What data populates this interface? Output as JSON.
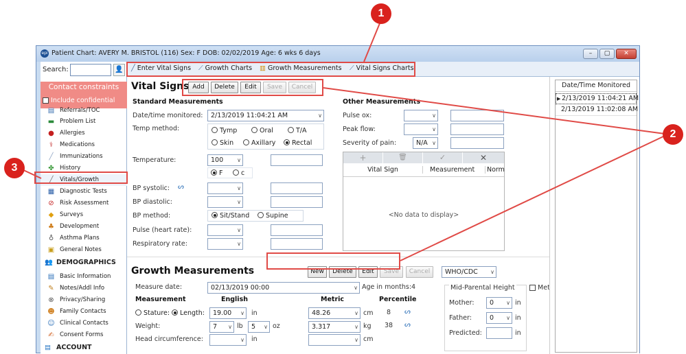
{
  "window": {
    "title": "Patient Chart: AVERY M. BRISTOL (116)  Sex: F  DOB: 02/02/2019  Age: 6 wks 6 days",
    "logo_text": "epi",
    "min": "–",
    "max": "▢",
    "close": "✕"
  },
  "sidebar": {
    "search_label": "Search:",
    "search_value": "",
    "contact_title": "Contact constraints",
    "include_confidential": "Include confidential",
    "items": [
      {
        "label": "Referrals/TOC",
        "icon": "referral-icon"
      },
      {
        "label": "Problem List",
        "icon": "list-icon"
      },
      {
        "label": "Allergies",
        "icon": "allergy-icon"
      },
      {
        "label": "Medications",
        "icon": "medication-icon"
      },
      {
        "label": "Immunizations",
        "icon": "syringe-icon"
      },
      {
        "label": "History",
        "icon": "history-icon"
      },
      {
        "label": "Vitals/Growth",
        "icon": "pencil-icon"
      },
      {
        "label": "Diagnostic Tests",
        "icon": "chart-icon"
      },
      {
        "label": "Risk Assessment",
        "icon": "risk-icon"
      },
      {
        "label": "Surveys",
        "icon": "survey-icon"
      },
      {
        "label": "Development",
        "icon": "development-icon"
      },
      {
        "label": "Asthma Plans",
        "icon": "asthma-icon"
      },
      {
        "label": "General Notes",
        "icon": "notes-icon"
      }
    ],
    "demographics_header": "DEMOGRAPHICS",
    "demo_items": [
      {
        "label": "Basic Information",
        "icon": "id-card-icon"
      },
      {
        "label": "Notes/Addl Info",
        "icon": "notes-icon"
      },
      {
        "label": "Privacy/Sharing",
        "icon": "privacy-icon"
      },
      {
        "label": "Family Contacts",
        "icon": "family-icon"
      },
      {
        "label": "Clinical Contacts",
        "icon": "contacts-icon"
      },
      {
        "label": "Consent Forms",
        "icon": "consent-icon"
      }
    ],
    "account_header": "ACCOUNT"
  },
  "tabs": [
    "Enter Vital Signs",
    "Growth Charts",
    "Growth Measurements",
    "Vital Signs Charts"
  ],
  "vitals": {
    "title": "Vital Signs",
    "buttons": {
      "add": "Add",
      "delete": "Delete",
      "edit": "Edit",
      "save": "Save",
      "cancel": "Cancel"
    },
    "standard_header": "Standard Measurements",
    "datetime_label": "Date/time monitored:",
    "datetime_value": "2/13/2019 11:04:21 AM",
    "temp_method_label": "Temp method:",
    "temp_methods": [
      "Tymp",
      "Oral",
      "T/A",
      "Skin",
      "Axillary",
      "Rectal"
    ],
    "temperature_label": "Temperature:",
    "temperature_value": "100",
    "temp_units": [
      "F",
      "c"
    ],
    "bp_systolic_label": "BP systolic:",
    "bp_diastolic_label": "BP diastolic:",
    "bp_method_label": "BP method:",
    "bp_methods": [
      "Sit/Stand",
      "Supine"
    ],
    "pulse_label": "Pulse (heart rate):",
    "resp_label": "Respiratory rate:",
    "other_header": "Other Measurements",
    "pulse_ox_label": "Pulse ox:",
    "peak_flow_label": "Peak flow:",
    "pain_label": "Severity of pain:",
    "pain_value": "N/A",
    "grid_toolbar": [
      "+",
      "🗑",
      "✓",
      "✕"
    ],
    "grid_cols": [
      "Vital Sign",
      "Measurement",
      "Norm"
    ],
    "grid_empty": "<No data to display>"
  },
  "dates": {
    "header": "Date/Time Monitored",
    "rows": [
      "2/13/2019 11:04:21 AM",
      "2/13/2019 11:02:08 AM"
    ]
  },
  "growth": {
    "title": "Growth Measurements",
    "buttons": {
      "new": "New",
      "delete": "Delete",
      "edit": "Edit",
      "save": "Save",
      "cancel": "Cancel"
    },
    "standard": "WHO/CDC",
    "measure_date_label": "Measure date:",
    "measure_date_value": "02/13/2019 00:00",
    "age_months": "Age in months:4",
    "col_measurement": "Measurement",
    "col_english": "English",
    "col_metric": "Metric",
    "col_percentile": "Percentile",
    "stature": "Stature:",
    "length": "Length:",
    "length_in": "19.00",
    "length_unit": "in",
    "length_cm": "48.26",
    "cm": "cm",
    "length_pct": "8",
    "weight_label": "Weight:",
    "weight_lb": "7",
    "lb": "lb",
    "weight_oz": "5",
    "oz": "oz",
    "weight_kg": "3.317",
    "kg": "kg",
    "weight_pct": "38",
    "head_label": "Head circumference:",
    "head_unit": "in",
    "head_cm": "cm",
    "midparental_header": "Mid-Parental Height",
    "metric_label": "Metric",
    "mother_label": "Mother:",
    "mother_value": "0",
    "father_label": "Father:",
    "father_value": "0",
    "predicted_label": "Predicted:",
    "in": "in"
  },
  "callouts": [
    "1",
    "2",
    "3"
  ]
}
